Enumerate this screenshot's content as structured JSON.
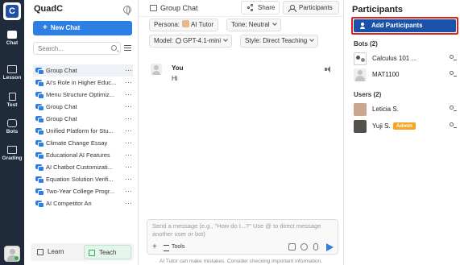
{
  "app": {
    "brand": "QuadC",
    "logo_letter": "C"
  },
  "rail": {
    "items": [
      {
        "label": "Chat",
        "icon": "chat-icon",
        "active": true
      },
      {
        "label": "Lesson",
        "icon": "lesson-icon"
      },
      {
        "label": "Test",
        "icon": "test-icon"
      },
      {
        "label": "Bots",
        "icon": "bots-icon"
      },
      {
        "label": "Grading",
        "icon": "grading-icon"
      }
    ]
  },
  "sidebar": {
    "new_chat_label": "New Chat",
    "search_placeholder": "Search...",
    "chats": [
      "Group Chat",
      "AI's Role in Higher Educ...",
      "Menu Structure Optimiz...",
      "Group Chat",
      "Group Chat",
      "Unified Platform for Stu...",
      "Climate Change Essay",
      "Educational AI Features",
      "AI Chatbot Customizati...",
      "Equation Solution Verifi...",
      "Two-Year College Progr...",
      "AI Competitor An"
    ],
    "modes": {
      "learn": "Learn",
      "teach": "Teach"
    }
  },
  "chat": {
    "title": "Group Chat",
    "share_label": "Share",
    "participants_label": "Participants",
    "persona_label": "Persona:",
    "persona_value": "AI Tutor",
    "tone_label": "Tone: Neutral",
    "model_label": "Model:",
    "model_value": "GPT-4.1-mini",
    "style_label": "Style: Direct Teaching",
    "message": {
      "author": "You",
      "text": "Hi"
    },
    "composer_placeholder": "Send a message (e.g., \"How do I...?\" Use @ to direct message another user or bot)",
    "tools_label": "Tools",
    "disclaimer": "AI Tutor can make mistakes. Consider checking important information."
  },
  "participants": {
    "title": "Participants",
    "add_label": "Add Participants",
    "bots_title": "Bots (2)",
    "bots": [
      "Calculus 101 ...",
      "MAT1100"
    ],
    "users_title": "Users (2)",
    "users": [
      {
        "name": "Leticia S.",
        "badge": ""
      },
      {
        "name": "Yuji S.",
        "badge": "Admin"
      }
    ]
  },
  "colors": {
    "accent": "#2d7fe3",
    "rail": "#1f2b3a",
    "add_button": "#1a52a8",
    "highlight_border": "#d9251c",
    "admin_badge": "#f5a623"
  }
}
